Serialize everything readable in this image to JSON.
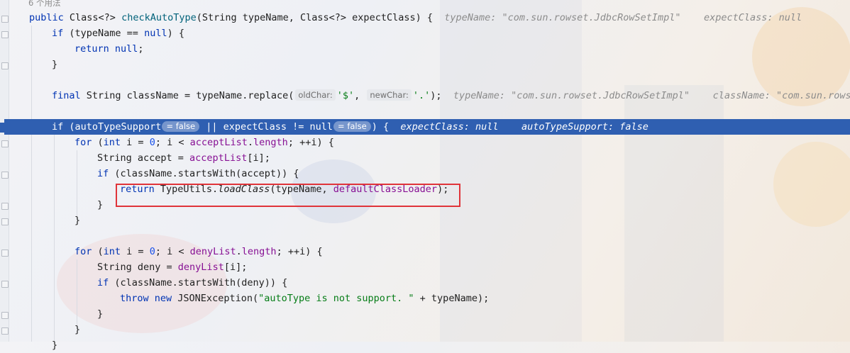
{
  "editor": {
    "usages_hint": "6 个用法",
    "lines": {
      "l1": {
        "a": "public ",
        "b": "Class<?> ",
        "c": "checkAutoType",
        "d": "(String typeName, Class<?> expectClass) {",
        "hint1": "typeName: \"com.sun.rowset.JdbcRowSetImpl\"",
        "hint2": "expectClass: null"
      },
      "l2": {
        "a": "if ",
        "b": "(typeName == ",
        "c": "null",
        "d": ") {"
      },
      "l3": {
        "a": "return ",
        "b": "null",
        "c": ";"
      },
      "l4": {
        "a": "}"
      },
      "l6": {
        "a": "final ",
        "b": "String className = typeName.replace(",
        "p1": "oldChar:",
        "v1": "'$'",
        "sep": ", ",
        "p2": "newChar:",
        "v2": "'.'",
        "end": ");",
        "hint1": "typeName: \"com.sun.rowset.JdbcRowSetImpl\"",
        "hint2": "className: \"com.sun.rowse"
      },
      "l8": {
        "a": "if ",
        "b": "(autoTypeSupport",
        "pill1": "= false",
        "c": " || expectClass != ",
        "d": "null",
        "pill2": "= false",
        "e": ") {",
        "hint1": "expectClass: null",
        "hint2": "autoTypeSupport: false"
      },
      "l9": {
        "a": "for ",
        "b": "(",
        "c": "int ",
        "d": "i = ",
        "e": "0",
        "f": "; i < ",
        "g": "acceptList",
        "h": ".",
        "i": "length",
        "j": "; ++i) {"
      },
      "l10": {
        "a": "String accept = ",
        "b": "acceptList",
        "c": "[i];"
      },
      "l11": {
        "a": "if ",
        "b": "(className.startsWith(accept)) {"
      },
      "l12": {
        "a": "return ",
        "b": "TypeUtils.",
        "c": "loadClass",
        "d": "(typeName, ",
        "e": "defaultClassLoader",
        "f": ");"
      },
      "l13": {
        "a": "}"
      },
      "l14": {
        "a": "}"
      },
      "l16": {
        "a": "for ",
        "b": "(",
        "c": "int ",
        "d": "i = ",
        "e": "0",
        "f": "; i < ",
        "g": "denyList",
        "h": ".",
        "i": "length",
        "j": "; ++i) {"
      },
      "l17": {
        "a": "String deny = ",
        "b": "denyList",
        "c": "[i];"
      },
      "l18": {
        "a": "if ",
        "b": "(className.startsWith(deny)) {"
      },
      "l19": {
        "a": "throw ",
        "b": "new ",
        "c": "JSONException(",
        "d": "\"autoType is not support. \"",
        "e": " + typeName);"
      },
      "l20": {
        "a": "}"
      },
      "l21": {
        "a": "}"
      },
      "l22": {
        "a": "}"
      }
    }
  },
  "colors": {
    "highlight_line": "#2f5fb1",
    "annotation_box": "#e0343a"
  }
}
